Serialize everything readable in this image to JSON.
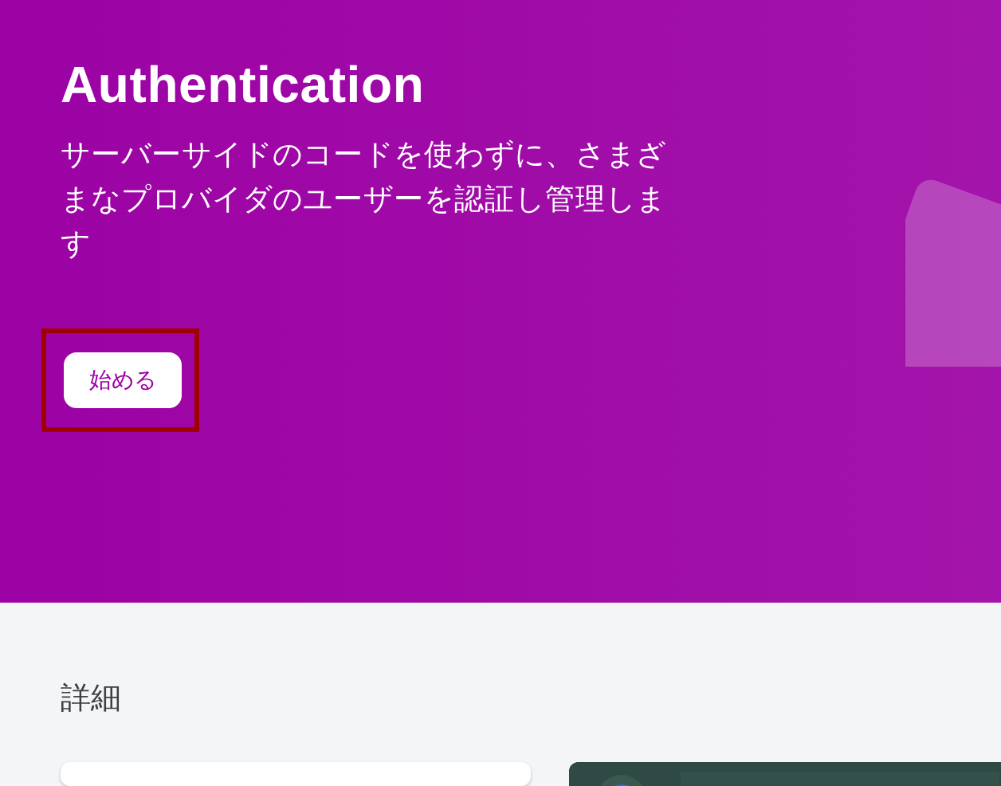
{
  "hero": {
    "title": "Authentication",
    "description": "サーバーサイドのコードを使わずに、さまざまなプロバイダのユーザーを認証し管理します",
    "button": {
      "label": "始める",
      "highlighted": true
    }
  },
  "details": {
    "heading": "詳細"
  }
}
